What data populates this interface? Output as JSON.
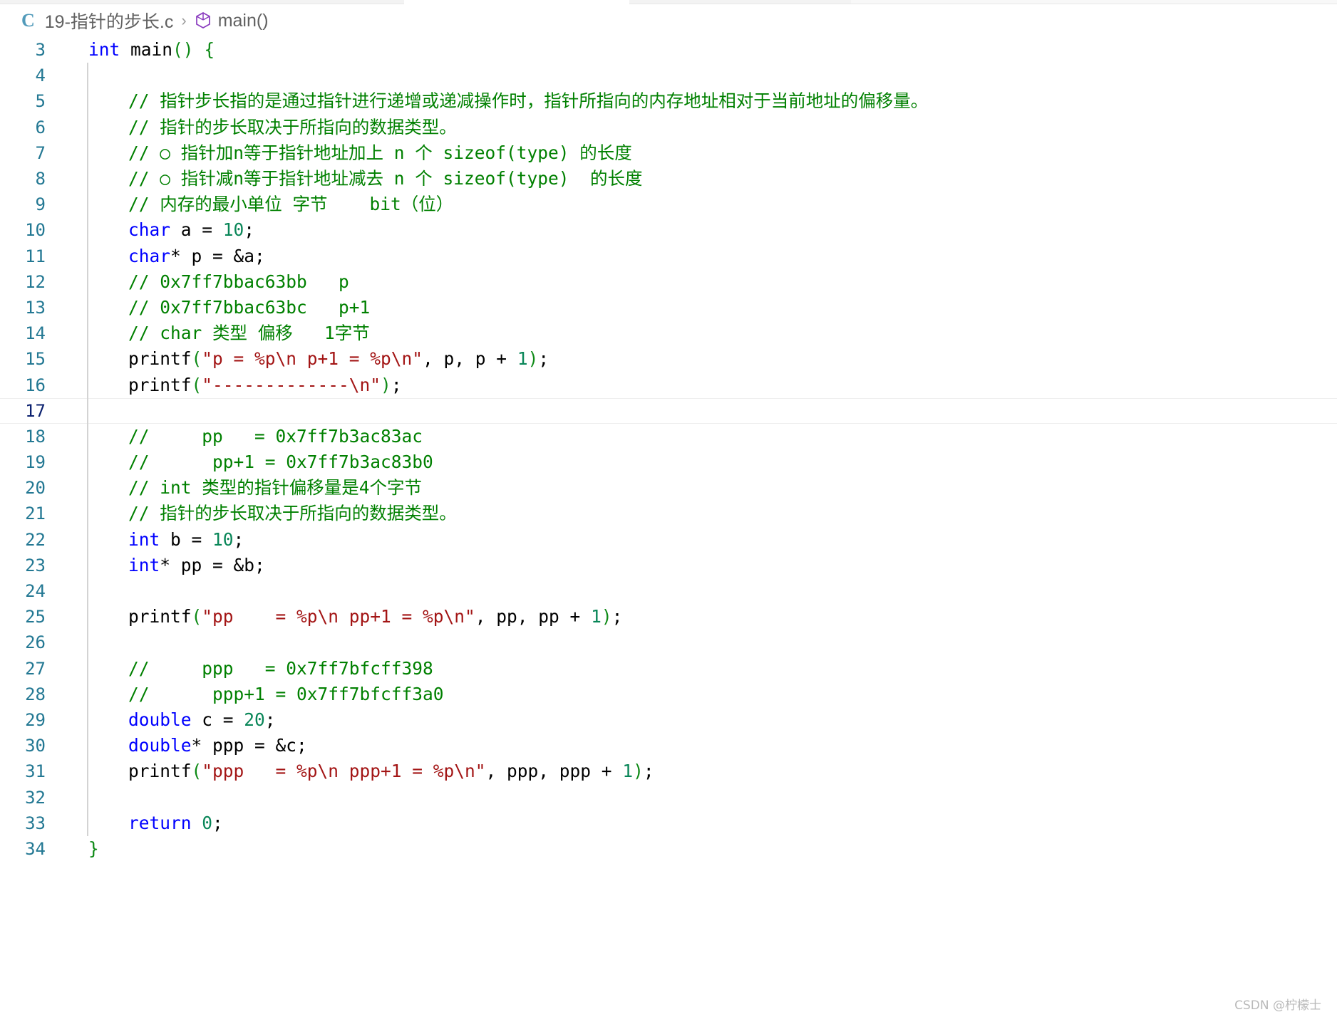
{
  "breadcrumb": {
    "lang_badge": "C",
    "file_name": "19-指针的步长.c",
    "separator": "›",
    "symbol_name": "main()"
  },
  "watermark": "CSDN @柠檬⼠",
  "colors": {
    "keyword": "#0000ff",
    "comment": "#008000",
    "string": "#a31515",
    "number": "#098658",
    "paren": "#0e8a16",
    "line_number": "#237893",
    "line_number_active": "#0b216f",
    "background": "#ffffff"
  },
  "editor": {
    "current_line": 17,
    "first_visible_line": 3,
    "last_visible_line": 34,
    "lines": [
      {
        "n": 3,
        "indent": 0,
        "guide": false,
        "tokens": [
          {
            "t": "kw",
            "s": "int"
          },
          {
            "t": "plain",
            "s": " main"
          },
          {
            "t": "paren",
            "s": "()"
          },
          {
            "t": "plain",
            "s": " "
          },
          {
            "t": "paren",
            "s": "{"
          }
        ]
      },
      {
        "n": 4,
        "indent": 0,
        "guide": true,
        "tokens": []
      },
      {
        "n": 5,
        "indent": 1,
        "guide": true,
        "tokens": [
          {
            "t": "cmt",
            "s": "// 指针步长指的是通过指针进行递增或递减操作时，指针所指向的内存地址相对于当前地址的偏移量。"
          }
        ]
      },
      {
        "n": 6,
        "indent": 1,
        "guide": true,
        "tokens": [
          {
            "t": "cmt",
            "s": "// 指针的步长取决于所指向的数据类型。"
          }
        ]
      },
      {
        "n": 7,
        "indent": 1,
        "guide": true,
        "tokens": [
          {
            "t": "cmt",
            "s": "// ○ 指针加n等于指针地址加上 n 个 sizeof(type) 的长度"
          }
        ]
      },
      {
        "n": 8,
        "indent": 1,
        "guide": true,
        "tokens": [
          {
            "t": "cmt",
            "s": "// ○ 指针减n等于指针地址减去 n 个 sizeof(type)  的长度"
          }
        ]
      },
      {
        "n": 9,
        "indent": 1,
        "guide": true,
        "tokens": [
          {
            "t": "cmt",
            "s": "// 内存的最小单位 字节    bit（位）"
          }
        ]
      },
      {
        "n": 10,
        "indent": 1,
        "guide": true,
        "tokens": [
          {
            "t": "kw",
            "s": "char"
          },
          {
            "t": "plain",
            "s": " a = "
          },
          {
            "t": "num",
            "s": "10"
          },
          {
            "t": "plain",
            "s": ";"
          }
        ]
      },
      {
        "n": 11,
        "indent": 1,
        "guide": true,
        "tokens": [
          {
            "t": "kw",
            "s": "char"
          },
          {
            "t": "plain",
            "s": "* p = &a;"
          }
        ]
      },
      {
        "n": 12,
        "indent": 1,
        "guide": true,
        "tokens": [
          {
            "t": "cmt",
            "s": "// 0x7ff7bbac63bb   p"
          }
        ]
      },
      {
        "n": 13,
        "indent": 1,
        "guide": true,
        "tokens": [
          {
            "t": "cmt",
            "s": "// 0x7ff7bbac63bc   p+1"
          }
        ]
      },
      {
        "n": 14,
        "indent": 1,
        "guide": true,
        "tokens": [
          {
            "t": "cmt",
            "s": "// char 类型 偏移   1字节"
          }
        ]
      },
      {
        "n": 15,
        "indent": 1,
        "guide": true,
        "tokens": [
          {
            "t": "plain",
            "s": "printf"
          },
          {
            "t": "paren",
            "s": "("
          },
          {
            "t": "str",
            "s": "\"p = %p\\n p+1 = %p\\n\""
          },
          {
            "t": "plain",
            "s": ", p, p + "
          },
          {
            "t": "num",
            "s": "1"
          },
          {
            "t": "paren",
            "s": ")"
          },
          {
            "t": "plain",
            "s": ";"
          }
        ]
      },
      {
        "n": 16,
        "indent": 1,
        "guide": true,
        "tokens": [
          {
            "t": "plain",
            "s": "printf"
          },
          {
            "t": "paren",
            "s": "("
          },
          {
            "t": "str",
            "s": "\"-------------\\n\""
          },
          {
            "t": "paren",
            "s": ")"
          },
          {
            "t": "plain",
            "s": ";"
          }
        ]
      },
      {
        "n": 17,
        "indent": 0,
        "guide": true,
        "tokens": []
      },
      {
        "n": 18,
        "indent": 1,
        "guide": true,
        "tokens": [
          {
            "t": "cmt",
            "s": "//     pp   = 0x7ff7b3ac83ac"
          }
        ]
      },
      {
        "n": 19,
        "indent": 1,
        "guide": true,
        "tokens": [
          {
            "t": "cmt",
            "s": "//      pp+1 = 0x7ff7b3ac83b0"
          }
        ]
      },
      {
        "n": 20,
        "indent": 1,
        "guide": true,
        "tokens": [
          {
            "t": "cmt",
            "s": "// int 类型的指针偏移量是4个字节"
          }
        ]
      },
      {
        "n": 21,
        "indent": 1,
        "guide": true,
        "tokens": [
          {
            "t": "cmt",
            "s": "// 指针的步长取决于所指向的数据类型。"
          }
        ]
      },
      {
        "n": 22,
        "indent": 1,
        "guide": true,
        "tokens": [
          {
            "t": "kw",
            "s": "int"
          },
          {
            "t": "plain",
            "s": " b = "
          },
          {
            "t": "num",
            "s": "10"
          },
          {
            "t": "plain",
            "s": ";"
          }
        ]
      },
      {
        "n": 23,
        "indent": 1,
        "guide": true,
        "tokens": [
          {
            "t": "kw",
            "s": "int"
          },
          {
            "t": "plain",
            "s": "* pp = &b;"
          }
        ]
      },
      {
        "n": 24,
        "indent": 0,
        "guide": true,
        "tokens": []
      },
      {
        "n": 25,
        "indent": 1,
        "guide": true,
        "tokens": [
          {
            "t": "plain",
            "s": "printf"
          },
          {
            "t": "paren",
            "s": "("
          },
          {
            "t": "str",
            "s": "\"pp    = %p\\n pp+1 = %p\\n\""
          },
          {
            "t": "plain",
            "s": ", pp, pp + "
          },
          {
            "t": "num",
            "s": "1"
          },
          {
            "t": "paren",
            "s": ")"
          },
          {
            "t": "plain",
            "s": ";"
          }
        ]
      },
      {
        "n": 26,
        "indent": 0,
        "guide": true,
        "tokens": []
      },
      {
        "n": 27,
        "indent": 1,
        "guide": true,
        "tokens": [
          {
            "t": "cmt",
            "s": "//     ppp   = 0x7ff7bfcff398"
          }
        ]
      },
      {
        "n": 28,
        "indent": 1,
        "guide": true,
        "tokens": [
          {
            "t": "cmt",
            "s": "//      ppp+1 = 0x7ff7bfcff3a0"
          }
        ]
      },
      {
        "n": 29,
        "indent": 1,
        "guide": true,
        "tokens": [
          {
            "t": "kw",
            "s": "double"
          },
          {
            "t": "plain",
            "s": " c = "
          },
          {
            "t": "num",
            "s": "20"
          },
          {
            "t": "plain",
            "s": ";"
          }
        ]
      },
      {
        "n": 30,
        "indent": 1,
        "guide": true,
        "tokens": [
          {
            "t": "kw",
            "s": "double"
          },
          {
            "t": "plain",
            "s": "* ppp = &c;"
          }
        ]
      },
      {
        "n": 31,
        "indent": 1,
        "guide": true,
        "tokens": [
          {
            "t": "plain",
            "s": "printf"
          },
          {
            "t": "paren",
            "s": "("
          },
          {
            "t": "str",
            "s": "\"ppp   = %p\\n ppp+1 = %p\\n\""
          },
          {
            "t": "plain",
            "s": ", ppp, ppp + "
          },
          {
            "t": "num",
            "s": "1"
          },
          {
            "t": "paren",
            "s": ")"
          },
          {
            "t": "plain",
            "s": ";"
          }
        ]
      },
      {
        "n": 32,
        "indent": 0,
        "guide": true,
        "tokens": []
      },
      {
        "n": 33,
        "indent": 1,
        "guide": true,
        "tokens": [
          {
            "t": "kw",
            "s": "return"
          },
          {
            "t": "plain",
            "s": " "
          },
          {
            "t": "num",
            "s": "0"
          },
          {
            "t": "plain",
            "s": ";"
          }
        ]
      },
      {
        "n": 34,
        "indent": 0,
        "guide": false,
        "tokens": [
          {
            "t": "paren",
            "s": "}"
          }
        ]
      }
    ]
  }
}
